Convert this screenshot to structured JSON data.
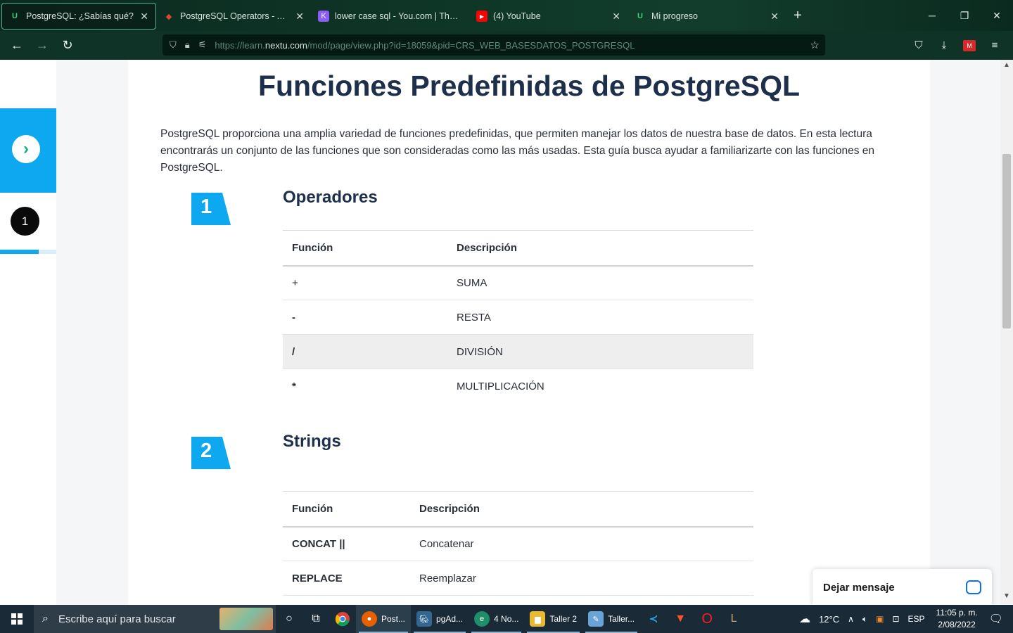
{
  "browser": {
    "tabs": [
      {
        "title": "PostgreSQL: ¿Sabías qué?",
        "favicon": "nextu-icon",
        "active": true
      },
      {
        "title": "PostgreSQL Operators - AlphaCodingSkills",
        "favicon": "alpha-icon"
      },
      {
        "title": "lower case sql - You.com | The se",
        "favicon": "youcom-icon"
      },
      {
        "title": "(4) YouTube",
        "favicon": "youtube-icon"
      },
      {
        "title": "Mi progreso",
        "favicon": "nextu-icon"
      }
    ],
    "url_prefix": "https://learn.",
    "url_domain": "nextu.com",
    "url_path": "/mod/page/view.php?id=18059&pid=CRS_WEB_BASESDATOS_POSTGRESQL"
  },
  "sidebar": {
    "nav_arrow": "›",
    "current_step": "1",
    "progress": 0.69
  },
  "page": {
    "title": "Funciones Predefinidas de PostgreSQL",
    "intro": "PostgreSQL proporciona una amplia variedad de funciones predefinidas, que permiten manejar los datos de nuestra base de datos. En esta lectura encontrarás un conjunto de las funciones que son consideradas como las más usadas. Esta guía busca ayudar a familiarizarte con las funciones en PostgreSQL.",
    "sections": [
      {
        "number": "1",
        "title": "Operadores",
        "headers": [
          "Función",
          "Descripción"
        ],
        "rows": [
          [
            "+",
            "SUMA"
          ],
          [
            "-",
            "RESTA"
          ],
          [
            "/",
            "DIVISIÓN"
          ],
          [
            "*",
            "MULTIPLICACIÓN"
          ]
        ]
      },
      {
        "number": "2",
        "title": "Strings",
        "headers": [
          "Función",
          "Descripción"
        ],
        "rows": [
          [
            "CONCAT ||",
            "Concatenar"
          ],
          [
            "REPLACE",
            "Reemplazar"
          ]
        ]
      }
    ]
  },
  "chat": {
    "label": "Dejar mensaje"
  },
  "taskbar": {
    "search_placeholder": "Escribe aquí para buscar",
    "apps": [
      {
        "label": "Post...",
        "icon": "firefox-icon",
        "color": "#e66000"
      },
      {
        "label": "pgAd...",
        "icon": "pgadmin-icon",
        "color": "#336791"
      },
      {
        "label": "4 No...",
        "icon": "edge-icon",
        "color": "#1e8f6a"
      },
      {
        "label": "Taller 2",
        "icon": "folder-icon",
        "color": "#e8b931"
      },
      {
        "label": "Taller...",
        "icon": "paint-icon",
        "color": "#6aa3d8"
      }
    ],
    "temperature": "12°C",
    "language": "ESP",
    "time": "11:05 p. m.",
    "date": "2/08/2022"
  },
  "colors": {
    "accent_blue": "#0da8f0",
    "title_navy": "#1d2f4b",
    "browser_green": "#0f3326"
  }
}
